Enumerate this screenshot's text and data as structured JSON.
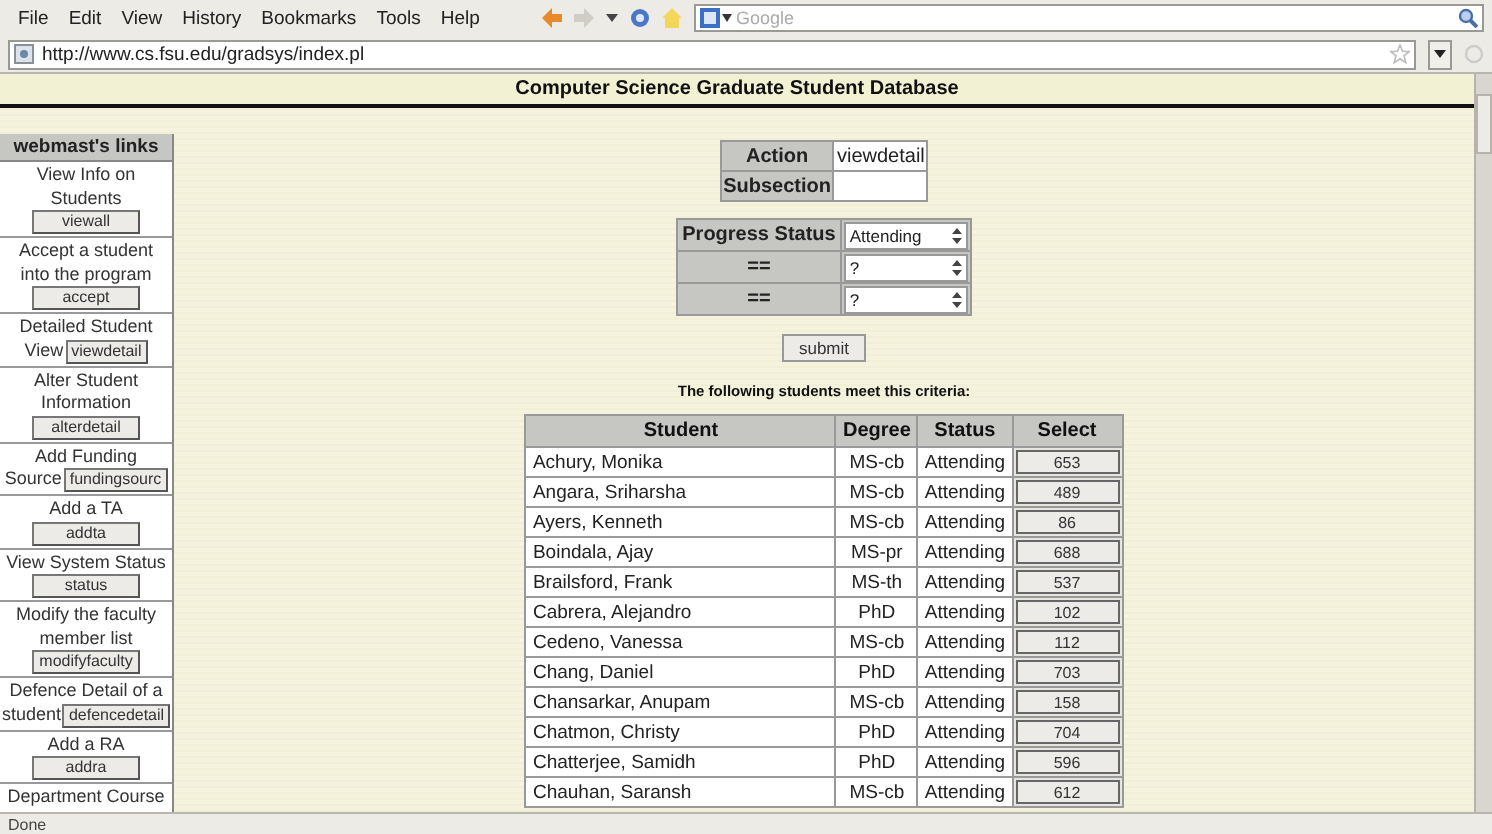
{
  "menu": [
    "File",
    "Edit",
    "View",
    "History",
    "Bookmarks",
    "Tools",
    "Help"
  ],
  "search": {
    "placeholder": "Google"
  },
  "address": {
    "value": "http://www.cs.fsu.edu/gradsys/index.pl"
  },
  "page_title": "Computer Science Graduate Student Database",
  "sidebar": {
    "title": "webmast's links",
    "items": [
      {
        "kind": "stacked",
        "label": "View Info on Students",
        "button": "viewall"
      },
      {
        "kind": "stacked",
        "label": "Accept a student into the program",
        "button": "accept"
      },
      {
        "kind": "inline",
        "label": "Detailed Student",
        "label_2": "View",
        "button": "viewdetail"
      },
      {
        "kind": "stacked",
        "label": "Alter Student Information",
        "button": "alterdetail"
      },
      {
        "kind": "inline",
        "label": "Add Funding",
        "label_2": "Source",
        "button": "fundingsourc"
      },
      {
        "kind": "stacked",
        "label": "Add a TA",
        "button": "addta"
      },
      {
        "kind": "stacked",
        "label": "View System Status",
        "button": "status"
      },
      {
        "kind": "stacked",
        "label": "Modify the faculty member list",
        "button": "modifyfaculty"
      },
      {
        "kind": "inline",
        "label": "Defence Detail of a",
        "label_2": "student",
        "button": "defencedetail"
      },
      {
        "kind": "stacked",
        "label": "Add a RA",
        "button": "addra"
      },
      {
        "kind": "text",
        "label": "Department Course"
      }
    ]
  },
  "action_table": [
    {
      "label": "Action",
      "value": "viewdetail"
    },
    {
      "label": "Subsection"
    }
  ],
  "filters": [
    {
      "label": "Progress Status",
      "value": "Attending"
    },
    {
      "label": "==",
      "value": "?"
    },
    {
      "label": "==",
      "value": "?"
    }
  ],
  "submit": "submit",
  "caption": "The following students meet this criteria:",
  "table": {
    "columns": [
      "Student",
      "Degree",
      "Status",
      "Select"
    ],
    "rows": [
      {
        "student": "Achury, Monika",
        "degree": "MS-cb",
        "status": "Attending",
        "select": "653"
      },
      {
        "student": "Angara, Sriharsha",
        "degree": "MS-cb",
        "status": "Attending",
        "select": "489"
      },
      {
        "student": "Ayers, Kenneth",
        "degree": "MS-cb",
        "status": "Attending",
        "select": "86"
      },
      {
        "student": "Boindala, Ajay",
        "degree": "MS-pr",
        "status": "Attending",
        "select": "688"
      },
      {
        "student": "Brailsford, Frank",
        "degree": "MS-th",
        "status": "Attending",
        "select": "537"
      },
      {
        "student": "Cabrera, Alejandro",
        "degree": "PhD",
        "status": "Attending",
        "select": "102"
      },
      {
        "student": "Cedeno, Vanessa",
        "degree": "MS-cb",
        "status": "Attending",
        "select": "112"
      },
      {
        "student": "Chang, Daniel",
        "degree": "PhD",
        "status": "Attending",
        "select": "703"
      },
      {
        "student": "Chansarkar, Anupam",
        "degree": "MS-cb",
        "status": "Attending",
        "select": "158"
      },
      {
        "student": "Chatmon, Christy",
        "degree": "PhD",
        "status": "Attending",
        "select": "704"
      },
      {
        "student": "Chatterjee, Samidh",
        "degree": "PhD",
        "status": "Attending",
        "select": "596"
      },
      {
        "student": "Chauhan, Saransh",
        "degree": "MS-cb",
        "status": "Attending",
        "select": "612"
      }
    ]
  },
  "status_bar": "Done"
}
